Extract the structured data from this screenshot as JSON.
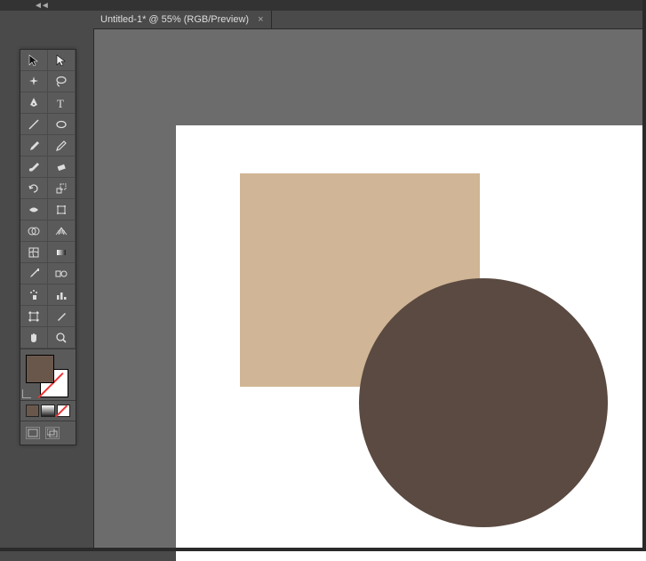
{
  "tab": {
    "label": "Untitled-1* @ 55% (RGB/Preview)",
    "close_glyph": "×"
  },
  "collapse_glyph": "◄◄",
  "colors": {
    "foreground": "#6a574c",
    "background": "#ffffff",
    "rect_fill": "#d0b596",
    "circle_fill": "#5a4a41",
    "chip1": "#6a574c",
    "chip2": "#0a0a0a"
  },
  "tools": [
    {
      "name": "selection-tool"
    },
    {
      "name": "direct-selection-tool"
    },
    {
      "name": "magic-wand-tool"
    },
    {
      "name": "lasso-tool"
    },
    {
      "name": "pen-tool"
    },
    {
      "name": "type-tool"
    },
    {
      "name": "line-segment-tool"
    },
    {
      "name": "ellipse-tool"
    },
    {
      "name": "paintbrush-tool"
    },
    {
      "name": "pencil-tool"
    },
    {
      "name": "blob-brush-tool"
    },
    {
      "name": "eraser-tool"
    },
    {
      "name": "rotate-tool"
    },
    {
      "name": "scale-tool"
    },
    {
      "name": "width-tool"
    },
    {
      "name": "free-transform-tool"
    },
    {
      "name": "shape-builder-tool"
    },
    {
      "name": "perspective-grid-tool"
    },
    {
      "name": "mesh-tool"
    },
    {
      "name": "gradient-tool"
    },
    {
      "name": "eyedropper-tool"
    },
    {
      "name": "blend-tool"
    },
    {
      "name": "symbol-sprayer-tool"
    },
    {
      "name": "column-graph-tool"
    },
    {
      "name": "artboard-tool"
    },
    {
      "name": "slice-tool"
    },
    {
      "name": "hand-tool"
    },
    {
      "name": "zoom-tool"
    }
  ]
}
